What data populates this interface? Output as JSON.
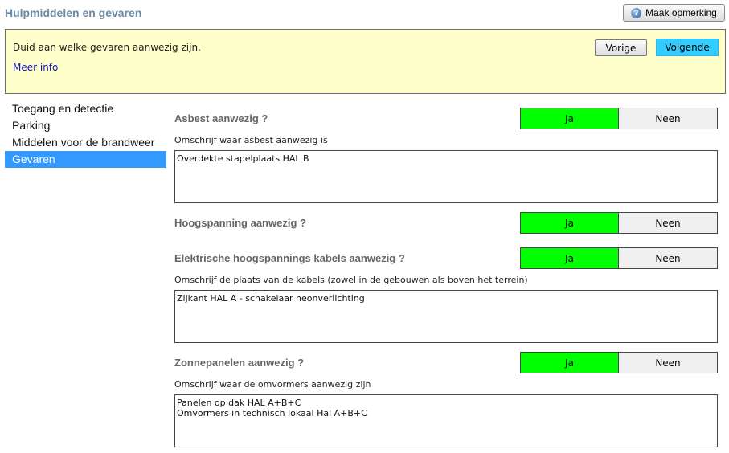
{
  "header": {
    "title": "Hulpmiddelen en gevaren",
    "remark_button": "Maak opmerking",
    "help_glyph": "?"
  },
  "info": {
    "text": "Duid aan welke gevaren aanwezig zijn.",
    "more_link": "Meer info",
    "prev_label": "Vorige",
    "next_label": "Volgende"
  },
  "sidebar": {
    "items": [
      {
        "label": "Toegang en detectie",
        "active": false
      },
      {
        "label": "Parking",
        "active": false
      },
      {
        "label": "Middelen voor de brandweer",
        "active": false
      },
      {
        "label": "Gevaren",
        "active": true
      }
    ]
  },
  "questions": [
    {
      "label": "Asbest aanwezig ?",
      "yes": "Ja",
      "no": "Neen",
      "selected": "Ja",
      "field_label": "Omschrijf waar asbest aanwezig is",
      "value": "Overdekte stapelplaats HAL B"
    },
    {
      "label": "Hoogspanning aanwezig ?",
      "yes": "Ja",
      "no": "Neen",
      "selected": "Ja"
    },
    {
      "label": "Elektrische hoogspannings kabels aanwezig ?",
      "yes": "Ja",
      "no": "Neen",
      "selected": "Ja",
      "field_label": "Omschrijf de plaats van de kabels (zowel in de gebouwen als boven het terrein)",
      "value": "Zijkant HAL A - schakelaar neonverlichting"
    },
    {
      "label": "Zonnepanelen aanwezig ?",
      "yes": "Ja",
      "no": "Neen",
      "selected": "Ja",
      "field_label": "Omschrijf waar de omvormers aanwezig zijn",
      "value": "Panelen op dak HAL A+B+C\nOmvormers in technisch lokaal Hal A+B+C"
    }
  ],
  "colors": {
    "selected_yes": "#00ff00",
    "unselected": "#f0f0f0",
    "active_nav": "#3399ff",
    "info_bg": "#ffffcc",
    "next_button": "#33ccff",
    "title": "#6b8aa6"
  }
}
